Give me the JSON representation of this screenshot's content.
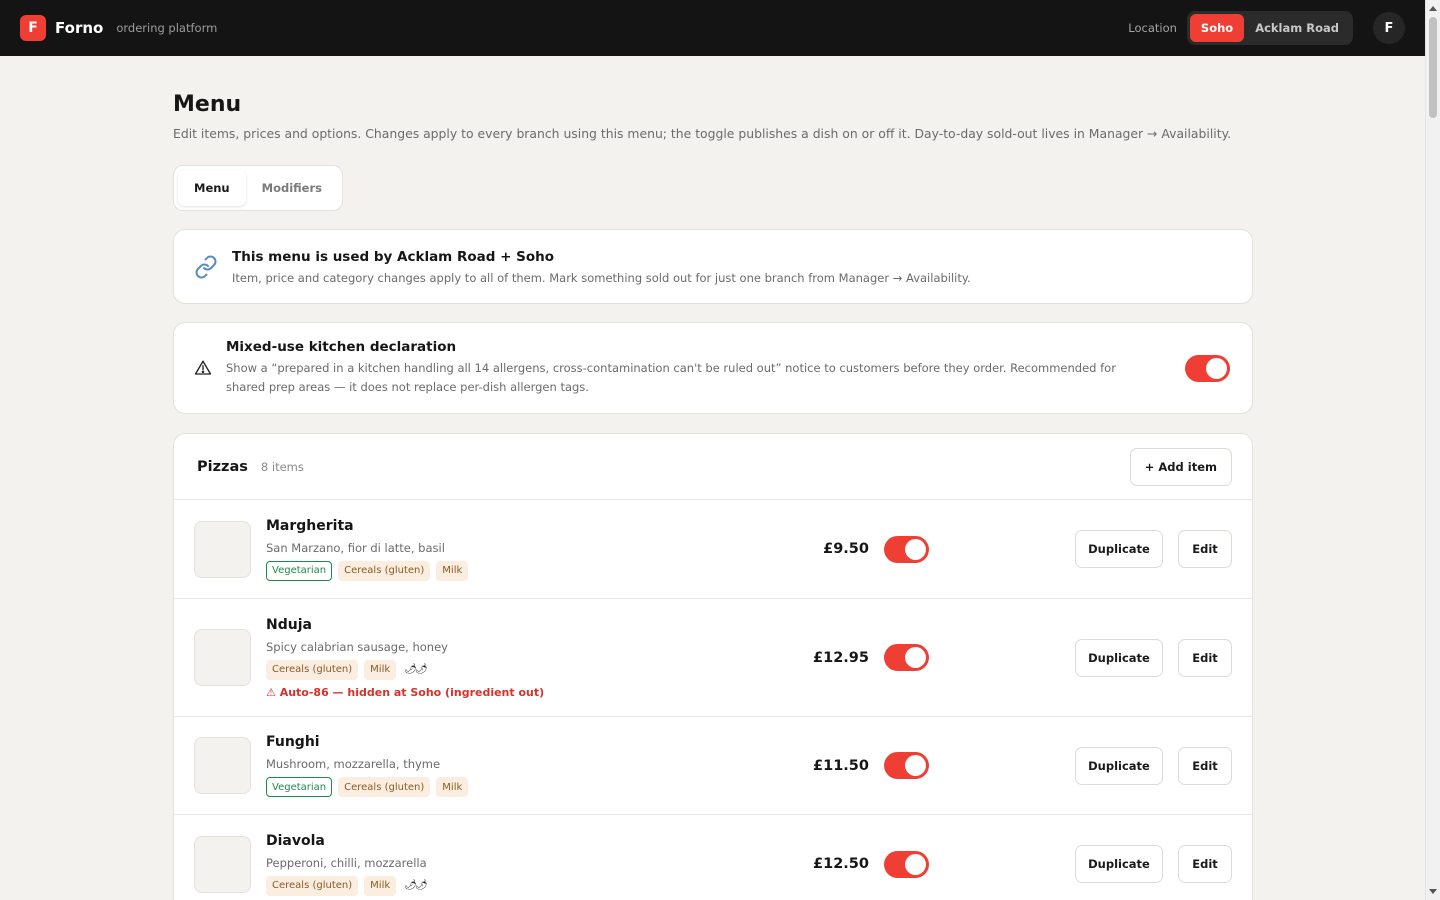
{
  "header": {
    "logo_letter": "F",
    "brand": "Forno",
    "subtitle": "ordering platform",
    "location_label": "Location",
    "locations": [
      {
        "label": "Soho",
        "active": true
      },
      {
        "label": "Acklam Road",
        "active": false
      }
    ],
    "avatar_letter": "F"
  },
  "page": {
    "title": "Menu",
    "description": "Edit items, prices and options. Changes apply to every branch using this menu; the toggle publishes a dish on or off it. Day-to-day sold-out lives in Manager → Availability."
  },
  "tabs": [
    {
      "label": "Menu",
      "active": true
    },
    {
      "label": "Modifiers",
      "active": false
    }
  ],
  "shared_notice": {
    "icon": "link-icon",
    "title": "This menu is used by Acklam Road + Soho",
    "description": "Item, price and category changes apply to all of them. Mark something sold out for just one branch from Manager → Availability."
  },
  "kitchen_declaration": {
    "icon": "warning-icon",
    "title": "Mixed-use kitchen declaration",
    "description": "Show a “prepared in a kitchen handling all 14 allergens, cross-contamination can't be ruled out” notice to customers before they order. Recommended for shared prep areas — it does not replace per-dish allergen tags.",
    "enabled": true
  },
  "section": {
    "title": "Pizzas",
    "count": "8 items",
    "add_label": "+ Add item"
  },
  "item_actions": {
    "duplicate": "Duplicate",
    "edit": "Edit"
  },
  "items": [
    {
      "name": "Margherita",
      "description": "San Marzano, fior di latte, basil",
      "vegetarian": "Vegetarian",
      "allergens": [
        "Cereals (gluten)",
        "Milk"
      ],
      "spice": "",
      "price": "£9.50",
      "published": true,
      "warning": ""
    },
    {
      "name": "Nduja",
      "description": "Spicy calabrian sausage, honey",
      "vegetarian": "",
      "allergens": [
        "Cereals (gluten)",
        "Milk"
      ],
      "spice": "🌶🌶",
      "price": "£12.95",
      "published": true,
      "warning": "⚠ Auto-86 — hidden at Soho (ingredient out)"
    },
    {
      "name": "Funghi",
      "description": "Mushroom, mozzarella, thyme",
      "vegetarian": "Vegetarian",
      "allergens": [
        "Cereals (gluten)",
        "Milk"
      ],
      "spice": "",
      "price": "£11.50",
      "published": true,
      "warning": ""
    },
    {
      "name": "Diavola",
      "description": "Pepperoni, chilli, mozzarella",
      "vegetarian": "",
      "allergens": [
        "Cereals (gluten)",
        "Milk"
      ],
      "spice": "🌶🌶",
      "price": "£12.50",
      "published": true,
      "warning": ""
    }
  ],
  "colors": {
    "accent": "#ef3f35",
    "topbar": "#141414",
    "background": "#f3f2ef",
    "vegetarian": "#1f8a4c",
    "allergen_bg": "#fbeee0",
    "warning_text": "#d6322a"
  }
}
